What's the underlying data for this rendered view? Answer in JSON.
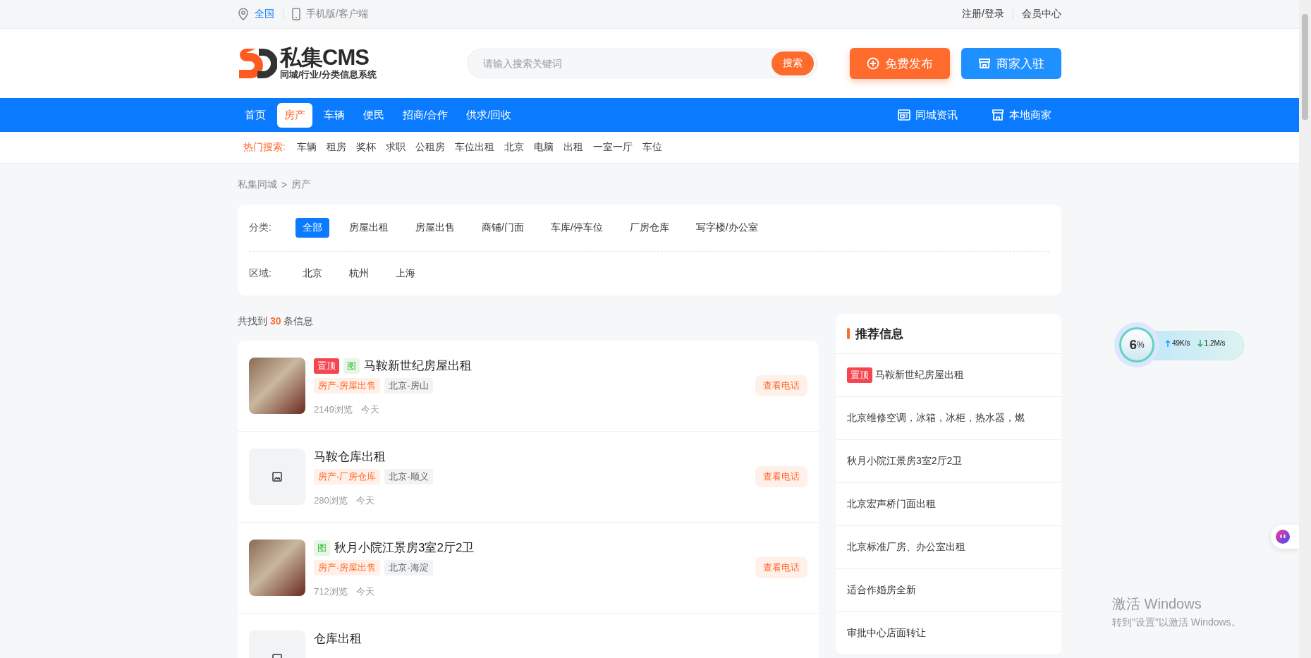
{
  "top_bar": {
    "location": "全国",
    "mobile_link": "手机版/客户端",
    "links": [
      "注册/登录",
      "会员中心"
    ]
  },
  "header": {
    "logo_title": "私集CMS",
    "logo_subtitle": "同城/行业/分类信息系统",
    "search": {
      "placeholder": "请输入搜索关键词",
      "button": "搜索"
    },
    "buttons": [
      {
        "label": "免费发布",
        "kind": "post"
      },
      {
        "label": "商家入驻",
        "kind": "merchant"
      }
    ]
  },
  "nav": {
    "items": [
      {
        "label": "首页",
        "selected": false
      },
      {
        "label": "房产",
        "selected": true
      },
      {
        "label": "车辆",
        "selected": false
      },
      {
        "label": "便民",
        "selected": false
      },
      {
        "label": "招商/合作",
        "selected": false
      },
      {
        "label": "供求/回收",
        "selected": false
      }
    ],
    "right_links": [
      {
        "label": "同城资讯",
        "kind": "news"
      },
      {
        "label": "本地商家",
        "kind": "shop"
      }
    ]
  },
  "hot_search": {
    "label": "热门搜索:",
    "terms": [
      "车辆",
      "租房",
      "奖杯",
      "求职",
      "公租房",
      "车位出租",
      "北京",
      "电脑",
      "出租",
      "一室一厅",
      "车位"
    ]
  },
  "breadcrumb": {
    "items": [
      "私集同城",
      "房产"
    ],
    "separator": ">"
  },
  "filters": [
    {
      "label": "分类:",
      "options": [
        {
          "label": "全部",
          "selected": true
        },
        {
          "label": "房屋出租",
          "selected": false
        },
        {
          "label": "房屋出售",
          "selected": false
        },
        {
          "label": "商铺/门面",
          "selected": false
        },
        {
          "label": "车库/停车位",
          "selected": false
        },
        {
          "label": "厂房仓库",
          "selected": false
        },
        {
          "label": "写字楼/办公室",
          "selected": false
        }
      ]
    },
    {
      "label": "区域:",
      "options": [
        {
          "label": "北京",
          "selected": false
        },
        {
          "label": "杭州",
          "selected": false
        },
        {
          "label": "上海",
          "selected": false
        }
      ]
    }
  ],
  "result_summary": "共找到 **30** 条信息",
  "listings": [
    {
      "thumbnail": {
        "kind": "photo"
      },
      "badges": [
        {
          "label": "置顶",
          "kind": "top"
        },
        {
          "label": "图",
          "kind": "image"
        }
      ],
      "title": "马鞍新世纪房屋出租",
      "tags": [
        "房产-房屋出售",
        "北京-房山"
      ],
      "views": "2149浏览",
      "time": "今天",
      "action": "查看电话"
    },
    {
      "thumbnail": {
        "kind": "placeholder"
      },
      "title": "马鞍仓库出租",
      "tags": [
        "房产-厂房仓库",
        "北京-顺义"
      ],
      "views": "280浏览",
      "time": "今天",
      "action": "查看电话"
    },
    {
      "thumbnail": {
        "kind": "photo"
      },
      "badges": [
        {
          "label": "图",
          "kind": "image"
        }
      ],
      "title": "秋月小院江景房3室2厅2卫",
      "tags": [
        "房产-房屋出售",
        "北京-海淀"
      ],
      "views": "712浏览",
      "time": "今天",
      "action": "查看电话"
    },
    {
      "thumbnail": {
        "kind": "placeholder"
      },
      "title": "仓库出租"
    }
  ],
  "recommend": {
    "title": "推荐信息",
    "items": [
      {
        "badge": "置顶",
        "title": "马鞍新世纪房屋出租"
      },
      {
        "title": "北京维修空调，冰箱，冰柜，热水器，燃"
      },
      {
        "title": "秋月小院江景房3室2厅2卫"
      },
      {
        "title": "北京宏声桥门面出租"
      },
      {
        "title": "北京标准厂房、办公室出租"
      },
      {
        "title": "适合作婚房全新"
      },
      {
        "title": "审批中心店面转让"
      }
    ]
  },
  "speed_widget": {
    "value": "6",
    "unit": "%",
    "upload": "49K/s",
    "download": "1.2M/s"
  },
  "windows_activation": {
    "title": "激活 Windows",
    "hint": "转到\"设置\"以激活 Windows。"
  }
}
